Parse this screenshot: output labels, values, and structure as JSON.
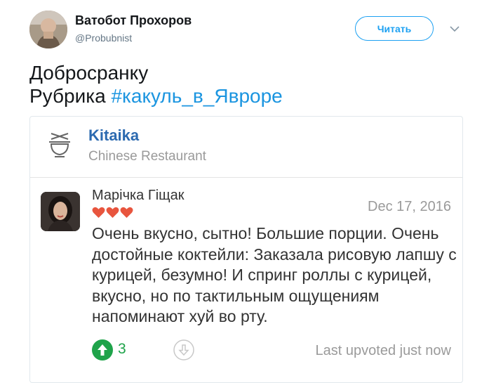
{
  "author": {
    "name": "Ватобот Прохоров",
    "handle": "@Probubnist",
    "follow_label": "Читать"
  },
  "tweet": {
    "line1": "Добросранку",
    "line2_prefix": "Рубрика ",
    "hashtag": "#какуль_в_Яврope"
  },
  "card": {
    "restaurant_name": "Kitaika",
    "restaurant_type": "Chinese Restaurant",
    "review": {
      "reviewer_name": "Марічка Гіщак",
      "date": "Dec 17, 2016",
      "rating_hearts": 3,
      "text": "Очень вкусно, сытно! Большие порции. Очень достойные коктейли: Заказала рисовую лапшу с курицей, безумно! И спринг роллы с курицей, вкусно, но по тактильным ощущениям напоминают хуй во рту.",
      "upvotes": "3",
      "last_upvoted": "Last upvoted just now"
    }
  },
  "colors": {
    "accent": "#1da1f2",
    "hashtag": "#1b95e0",
    "restaurant": "#2c6ab0",
    "heart": "#e8553e",
    "upvote": "#1fa34a"
  },
  "icons": [
    "chevron-down-icon",
    "bowl-logo-icon",
    "heart-icon",
    "upvote-arrow-icon",
    "downvote-arrow-icon"
  ]
}
